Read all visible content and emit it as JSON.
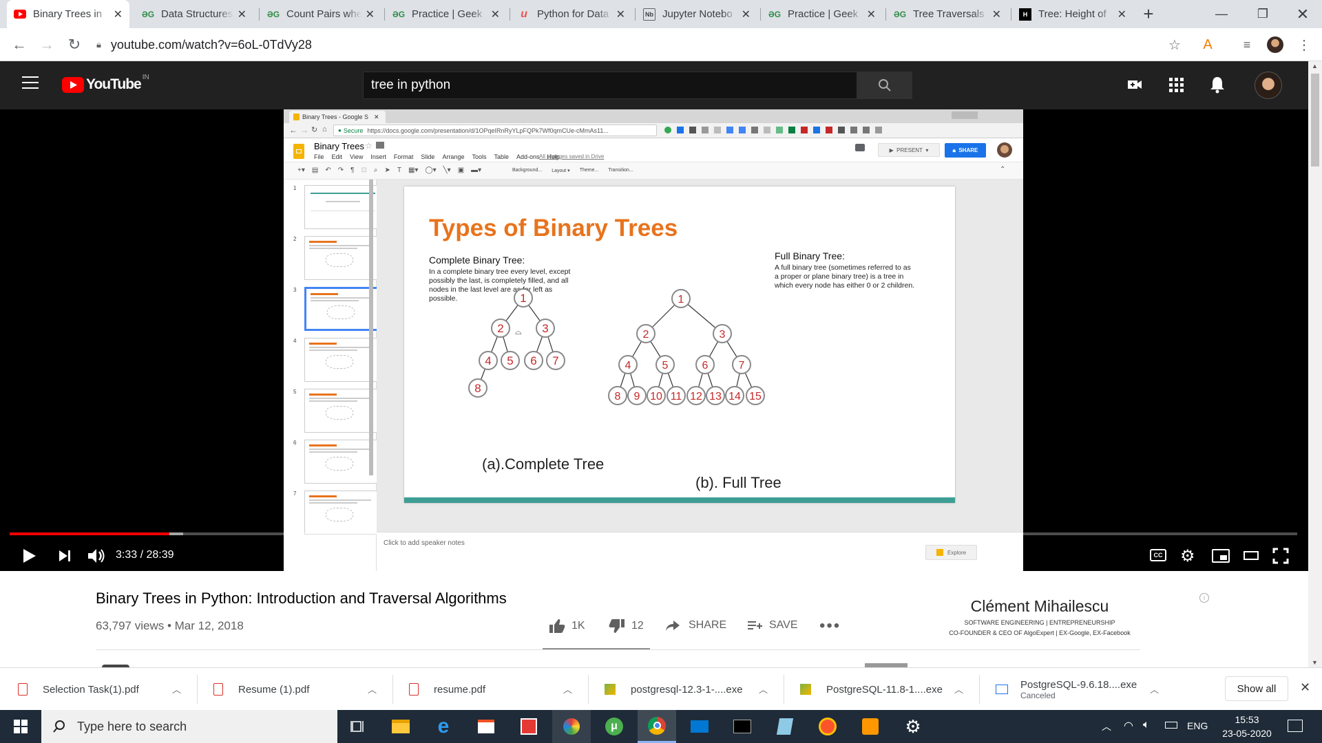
{
  "browser": {
    "tabs": [
      {
        "title": "Binary Trees in",
        "icon": "youtube-icon",
        "active": true
      },
      {
        "title": "Data Structures",
        "icon": "gfg-icon"
      },
      {
        "title": "Count Pairs whe",
        "icon": "gfg-icon"
      },
      {
        "title": "Practice | Geek",
        "icon": "gfg-icon"
      },
      {
        "title": "Python for Data",
        "icon": "udemy-icon"
      },
      {
        "title": "Jupyter Notebo",
        "icon": "jupyter-icon"
      },
      {
        "title": "Practice | Geek",
        "icon": "gfg-icon"
      },
      {
        "title": "Tree Traversals",
        "icon": "gfg-icon"
      },
      {
        "title": "Tree: Height of",
        "icon": "hackerrank-icon"
      }
    ],
    "url": "youtube.com/watch?v=6oL-0TdVy28"
  },
  "youtube": {
    "logo_text": "YouTube",
    "region": "IN",
    "search_value": "tree in python"
  },
  "video": {
    "time": "3:33 / 28:39",
    "progress_fraction": 0.124,
    "buffered_fraction": 0.135,
    "title": "Binary Trees in Python: Introduction and Traversal Algorithms",
    "views_date": "63,797 views • Mar 12, 2018",
    "likes": "1K",
    "dislikes": "12",
    "share_label": "SHARE",
    "save_label": "SAVE",
    "channel_name": "Clément Mihailescu",
    "channel_tagline": "SOFTWARE ENGINEERING | ENTREPRENEURSHIP",
    "channel_sub": "CO-FOUNDER & CEO OF AlgoExpert | EX-Google, EX-Facebook"
  },
  "slides": {
    "inner_tab": "Binary Trees - Google S",
    "inner_url": "https://docs.google.com/presentation/d/1OPqeIRnRyYLpFQPk7Wf0qmCUe-cMmAs11...",
    "secure": "Secure",
    "doc_title": "Binary Trees",
    "menu": [
      "File",
      "Edit",
      "View",
      "Insert",
      "Format",
      "Slide",
      "Arrange",
      "Tools",
      "Table",
      "Add-ons",
      "Help"
    ],
    "saved": "All changes saved in Drive",
    "present": "PRESENT",
    "share": "SHARE",
    "toolbar_items": [
      "Background...",
      "Layout",
      "Theme...",
      "Transition..."
    ],
    "thumb_numbers": [
      "1",
      "2",
      "3",
      "4",
      "5",
      "6",
      "7"
    ],
    "slide_title": "Types of Binary Trees",
    "complete_heading": "Complete Binary Tree:",
    "complete_text_lines": [
      "In a complete binary tree every level, except",
      "possibly the last, is completely filled, and all",
      "nodes in the last level are as far left as",
      "possible."
    ],
    "full_heading": "Full Binary Tree:",
    "full_text_lines": [
      "A full binary tree (sometimes referred to as",
      "a proper or plane binary tree) is a tree in",
      "which every node has either 0 or 2 children."
    ],
    "complete_caption": "(a).Complete Tree",
    "full_caption": "(b). Full Tree",
    "complete_nodes": [
      "1",
      "2",
      "3",
      "4",
      "5",
      "6",
      "7",
      "8"
    ],
    "full_nodes": [
      "1",
      "2",
      "3",
      "4",
      "5",
      "6",
      "7",
      "8",
      "9",
      "10",
      "11",
      "12",
      "13",
      "14",
      "15"
    ],
    "speaker_notes": "Click to add speaker notes",
    "explore": "Explore"
  },
  "downloads": {
    "items": [
      {
        "name": "Selection Task(1).pdf",
        "status": ""
      },
      {
        "name": "Resume (1).pdf",
        "status": ""
      },
      {
        "name": "resume.pdf",
        "status": ""
      },
      {
        "name": "postgresql-12.3-1-....exe",
        "status": ""
      },
      {
        "name": "PostgreSQL-11.8-1....exe",
        "status": ""
      },
      {
        "name": "PostgreSQL-9.6.18....exe",
        "status": "Canceled"
      }
    ],
    "show_all": "Show all"
  },
  "taskbar": {
    "search_placeholder": "Type here to search",
    "lang": "ENG",
    "time": "15:53",
    "date": "23-05-2020"
  },
  "colors": {
    "yt_red": "#ff0000",
    "slide_title_orange": "#e8731c",
    "node_red": "#c62828",
    "slides_blue": "#1a73e8",
    "taskbar": "#1f2b38"
  }
}
